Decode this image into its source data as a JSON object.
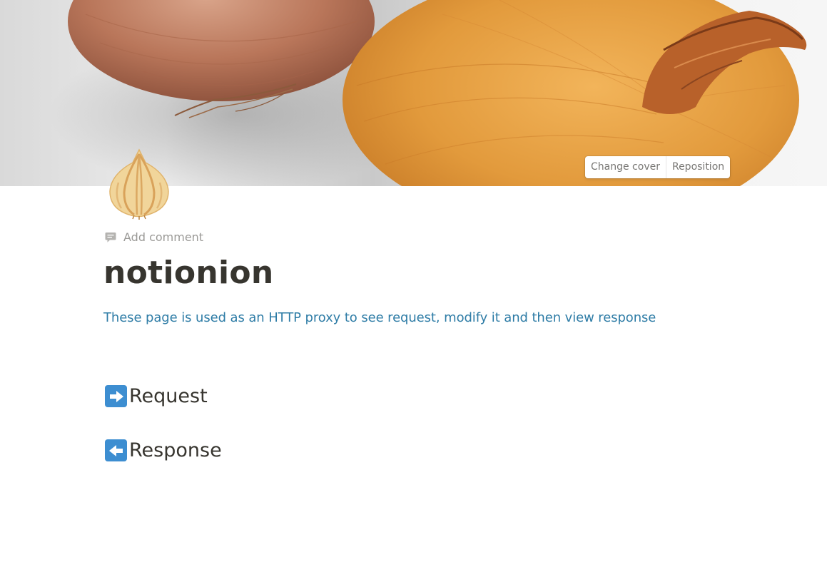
{
  "cover": {
    "image": "onion-photo",
    "actions": {
      "change_cover": "Change cover",
      "reposition": "Reposition"
    }
  },
  "page_icon": "onion-icon",
  "add_comment": {
    "icon": "comment-icon",
    "label": "Add comment"
  },
  "title": "notionion",
  "description": "These page is used as an HTTP proxy to see request, modify it and then view response",
  "sections": [
    {
      "icon": "arrow-right-icon",
      "label": "Request"
    },
    {
      "icon": "arrow-left-icon",
      "label": "Response"
    }
  ],
  "colors": {
    "title": "#37352f",
    "description": "#2e7ca6",
    "muted": "#9b9a97",
    "arrow_box": "#3d8ed1"
  }
}
